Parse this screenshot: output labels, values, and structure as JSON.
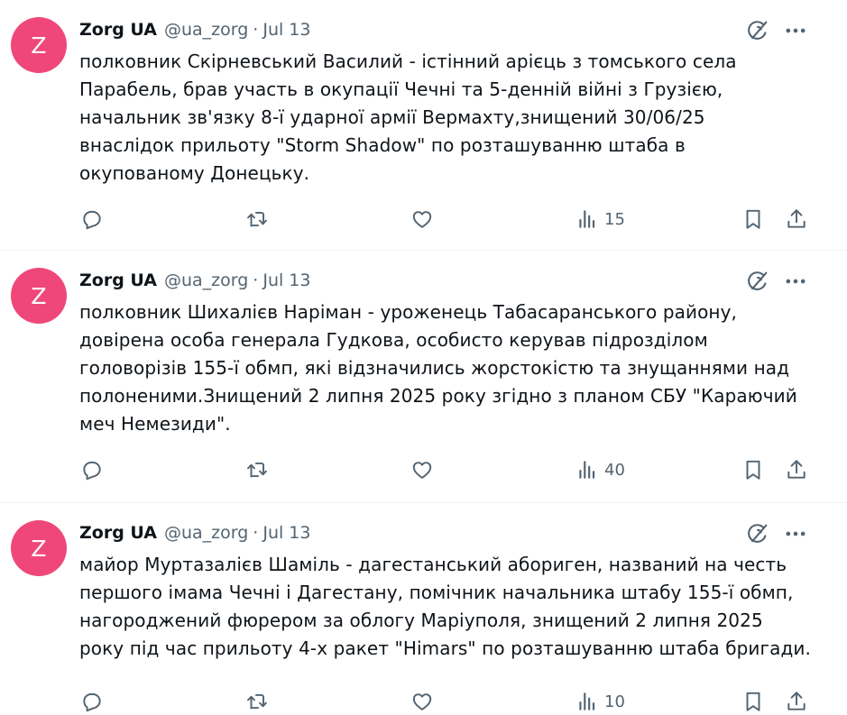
{
  "tweets": [
    {
      "avatar_letter": "Z",
      "name": "Zorg UA",
      "handle": "@ua_zorg",
      "separator": "·",
      "date": "Jul 13",
      "text": "полковник Скірневський Василий - істінний арієць з томського села\nПарабель, брав участь в окупації Чечні та 5-денній війні з Грузією,\nначальник зв'язку 8-ї ударної армії Вермахту,знищений 30/06/25\nвнаслідок прильоту  \"Storm Shadow\" по розташуванню штаба в\nокупованому Донецьку.",
      "views": "15"
    },
    {
      "avatar_letter": "Z",
      "name": "Zorg UA",
      "handle": "@ua_zorg",
      "separator": "·",
      "date": "Jul 13",
      "text": "полковник Шихалієв Наріман - уроженець Табасаранського району,\nдовірена особа генерала Гудкова, особисто керував підрозділом\nголоворізів 155-ї обмп, які відзначились жорстокістю та знущаннями над\nполоненими.Знищений 2 липня 2025 року згідно з планом СБУ \"Караючий\nмеч Немезиди\".",
      "views": "40"
    },
    {
      "avatar_letter": "Z",
      "name": "Zorg UA",
      "handle": "@ua_zorg",
      "separator": "·",
      "date": "Jul 13",
      "text": "майор Муртазалієв Шаміль - дагестанський абориген, названий на честь\nпершого імама Чечні і Дагестану, помічник начальника штабу 155-ї обмп,\nнагороджений фюрером за облогу Маріуполя,  знищений 2 липня 2025\nроку під час прильоту 4-х ракет \"Himars\" по розташуванню штаба бригади.",
      "views": "10"
    }
  ],
  "icons": {
    "reply": "reply-icon",
    "retweet": "retweet-icon",
    "like": "like-icon",
    "views": "views-icon",
    "bookmark": "bookmark-icon",
    "share": "share-icon",
    "grok": "grok-icon",
    "more": "more-icon"
  },
  "colors": {
    "avatar_bg": "#f0477a",
    "text": "#0f1419",
    "secondary": "#536471",
    "divider": "#eff3f4"
  }
}
